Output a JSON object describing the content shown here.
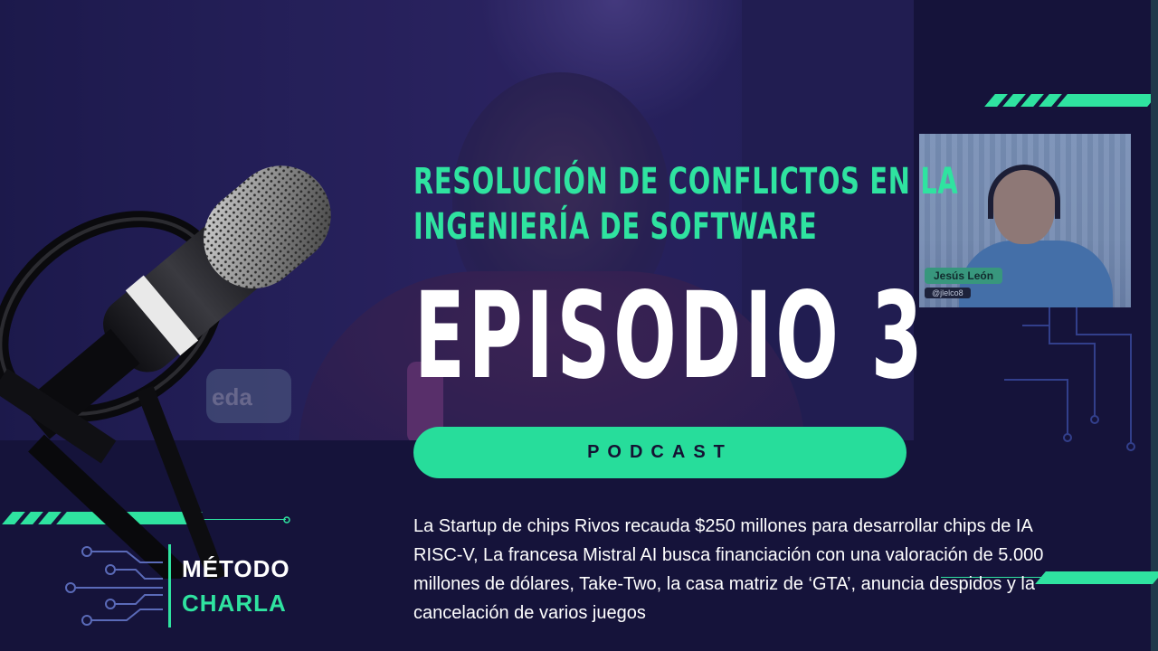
{
  "colors": {
    "accent": "#2fe3a0",
    "pill": "#27dd9b",
    "background": "#15133a",
    "title": "#ffffff"
  },
  "video": {
    "badge_text": "eda"
  },
  "guest": {
    "name": "Jesús León",
    "handle": "@jlelco8"
  },
  "subtitle": "Resolución de conflictos en la ingeniería de software",
  "episode": "EPISODIO 3",
  "tag_button": "PODCAST",
  "description": "La Startup de chips Rivos recauda $250 millones para desarrollar chips de IA RISC-V, La francesa Mistral AI busca financiación con una valoración de 5.000 millones de dólares, Take-Two, la casa matriz de ‘GTA’, anuncia despidos y la cancelación de varios juegos",
  "logo": {
    "line1": "MÉTODO",
    "line2": "CHARLA"
  },
  "icons": [
    "microphone-icon",
    "circuit-icon"
  ]
}
